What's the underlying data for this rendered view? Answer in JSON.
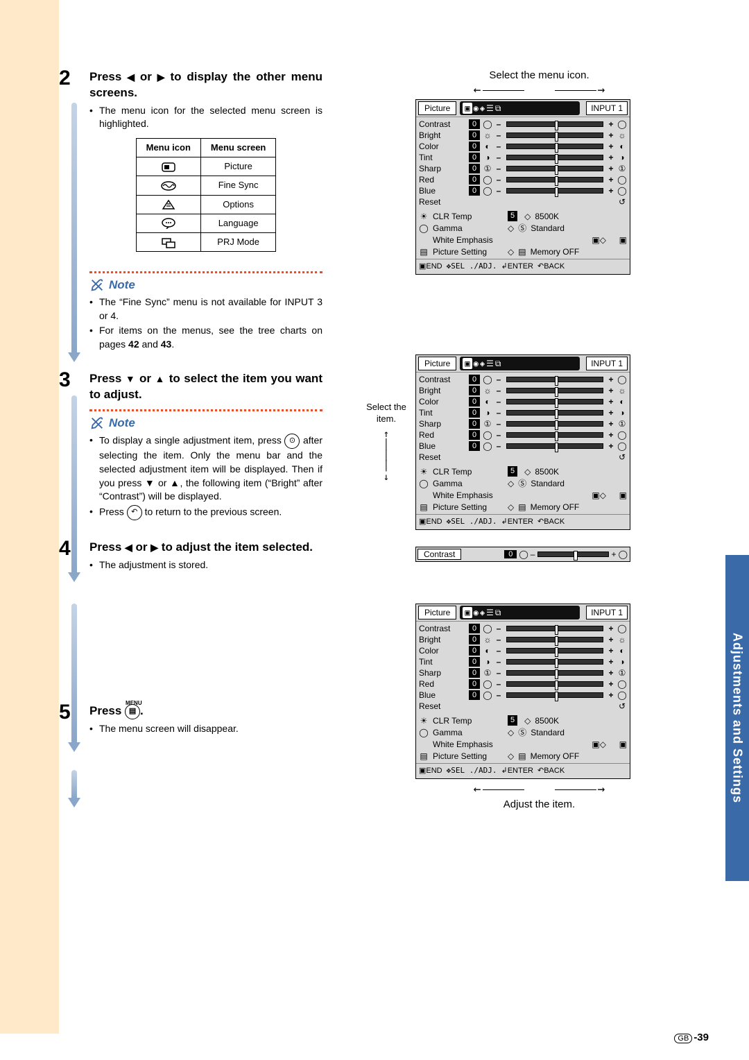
{
  "side_tab": "Adjustments and Settings",
  "page_number": "-39",
  "page_prefix": "GB",
  "steps": {
    "s2": {
      "num": "2",
      "title_a": "Press ",
      "title_b": " or ",
      "title_c": " to display the other menu screens.",
      "bullet1": "The menu icon for the selected menu screen is highlighted.",
      "th1": "Menu icon",
      "th2": "Menu screen",
      "rows": [
        "Picture",
        "Fine Sync",
        "Options",
        "Language",
        "PRJ Mode"
      ]
    },
    "note1": {
      "label": "Note",
      "b1": "The “Fine Sync” menu is not available for INPUT 3 or 4.",
      "b2_a": "For items on the menus, see the tree charts on pages ",
      "b2_bold1": "42",
      "b2_mid": " and ",
      "b2_bold2": "43",
      "b2_end": "."
    },
    "s3": {
      "num": "3",
      "title_a": "Press ",
      "title_b": " or ",
      "title_c": " to select the item you want to adjust."
    },
    "note2": {
      "label": "Note",
      "b1_a": "To display a single adjustment item, press ",
      "b1_b": " after selecting the item. Only the menu bar and the selected adjustment item will be displayed. Then if you press ",
      "b1_c": " or ",
      "b1_d": ", the following item (“Bright” after “Contrast”) will be displayed.",
      "b2_a": "Press ",
      "b2_b": " to return to the previous screen."
    },
    "s4": {
      "num": "4",
      "title_a": "Press ",
      "title_b": " or ",
      "title_c": " to adjust the item selected.",
      "bullet1": "The adjustment is stored."
    },
    "s5": {
      "num": "5",
      "title_a": "Press ",
      "title_b": ".",
      "bullet1": "The menu screen will disappear.",
      "key_label": "MENU"
    }
  },
  "right": {
    "anno_top": "Select the menu icon.",
    "anno_sel": "Select the item.",
    "anno_sel2": "",
    "anno_adj": "Adjust the item."
  },
  "osd": {
    "title": "Picture",
    "input": "INPUT 1",
    "rows": [
      {
        "label": "Contrast",
        "v": "0"
      },
      {
        "label": "Bright",
        "v": "0"
      },
      {
        "label": "Color",
        "v": "0"
      },
      {
        "label": "Tint",
        "v": "0"
      },
      {
        "label": "Sharp",
        "v": "0"
      },
      {
        "label": "Red",
        "v": "0"
      },
      {
        "label": "Blue",
        "v": "0"
      }
    ],
    "reset": "Reset",
    "clr_label": "CLR Temp",
    "clr_chip": "5",
    "clr_val": "8500K",
    "gamma_label": "Gamma",
    "gamma_val": "Standard",
    "we_label": "White Emphasis",
    "ps_label": "Picture Setting",
    "ps_val": "Memory OFF",
    "footer": {
      "end": "END",
      "sel": "SEL ./ADJ.",
      "enter": "ENTER",
      "back": "BACK"
    },
    "contrast_label": "Contrast",
    "contrast_v": "0"
  }
}
